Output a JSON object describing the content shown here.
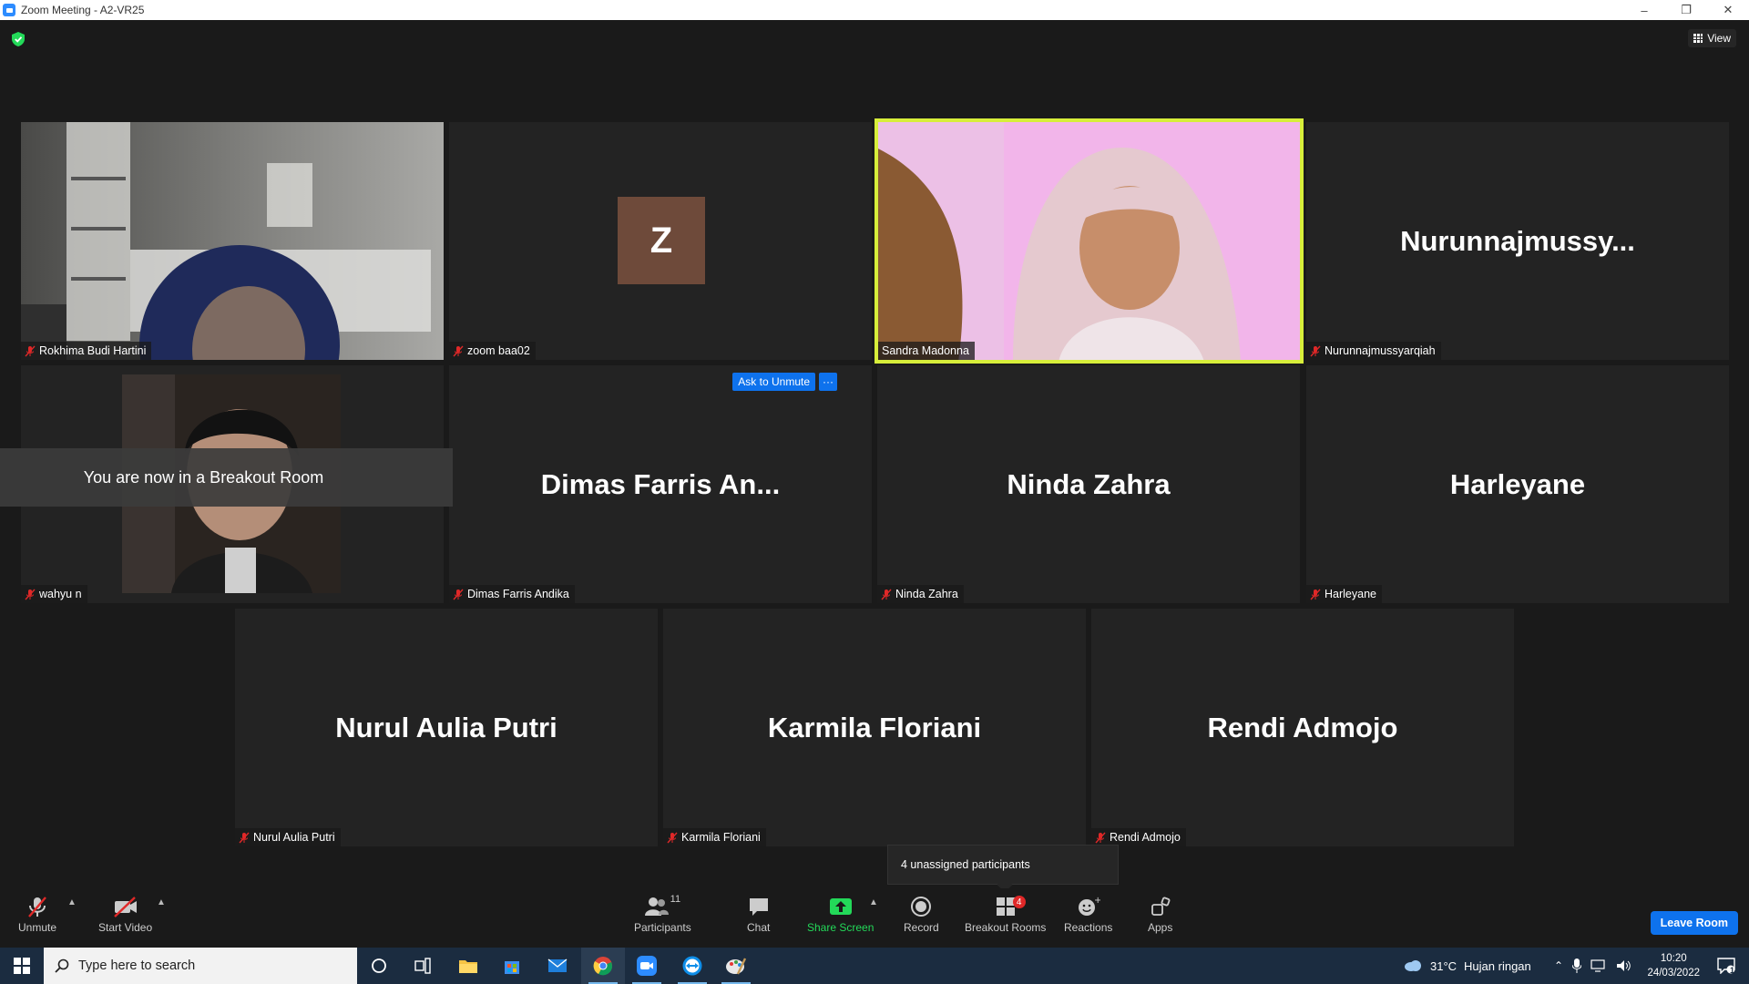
{
  "window": {
    "title": "Zoom Meeting - A2-VR25",
    "controls": [
      "minimize",
      "restore",
      "close"
    ]
  },
  "header": {
    "view_label": "View"
  },
  "tiles": [
    {
      "name": "Rokhima Budi Hartini",
      "display": "",
      "type": "video"
    },
    {
      "name": "zoom baa02",
      "display": "",
      "type": "avatar",
      "avatar_letter": "Z",
      "avatar_color": "#6e4a3a"
    },
    {
      "name": "Sandra Madonna",
      "display": "",
      "type": "video",
      "active_speaker": true
    },
    {
      "name": "Nurunnajmussyarqiah",
      "display": "Nurunnajmussy...",
      "type": "name"
    },
    {
      "name": "wahyu n",
      "display": "",
      "type": "video"
    },
    {
      "name": "Dimas Farris Andika",
      "display": "Dimas Farris An...",
      "type": "name"
    },
    {
      "name": "Ninda Zahra",
      "display": "Ninda Zahra",
      "type": "name"
    },
    {
      "name": "Harleyane",
      "display": "Harleyane",
      "type": "name"
    },
    {
      "name": "Nurul Aulia Putri",
      "display": "Nurul Aulia Putri",
      "type": "name"
    },
    {
      "name": "Karmila Floriani",
      "display": "Karmila Floriani",
      "type": "name"
    },
    {
      "name": "Rendi Admojo",
      "display": "Rendi Admojo",
      "type": "name"
    }
  ],
  "hover_controls": {
    "ask_to_unmute": "Ask to Unmute",
    "more": "···"
  },
  "breakout_toast": "You are now in a Breakout Room",
  "unassigned_popup": "4 unassigned participants",
  "toolbar": {
    "unmute": "Unmute",
    "start_video": "Start Video",
    "participants": "Participants",
    "participants_count": "11",
    "chat": "Chat",
    "share_screen": "Share Screen",
    "record": "Record",
    "breakout_rooms": "Breakout Rooms",
    "breakout_badge": "4",
    "reactions": "Reactions",
    "apps": "Apps",
    "leave_room": "Leave Room"
  },
  "taskbar": {
    "search_placeholder": "Type here to search",
    "weather_temp": "31°C",
    "weather_desc": "Hujan ringan",
    "time": "10:20",
    "date": "24/03/2022",
    "notification_count": "1"
  },
  "colors": {
    "accent": "#0e72ed",
    "active_speaker_border": "#d7ee3a",
    "share_screen_green": "#23d959",
    "badge_red": "#e02828",
    "mic_off_red": "#e02828"
  }
}
